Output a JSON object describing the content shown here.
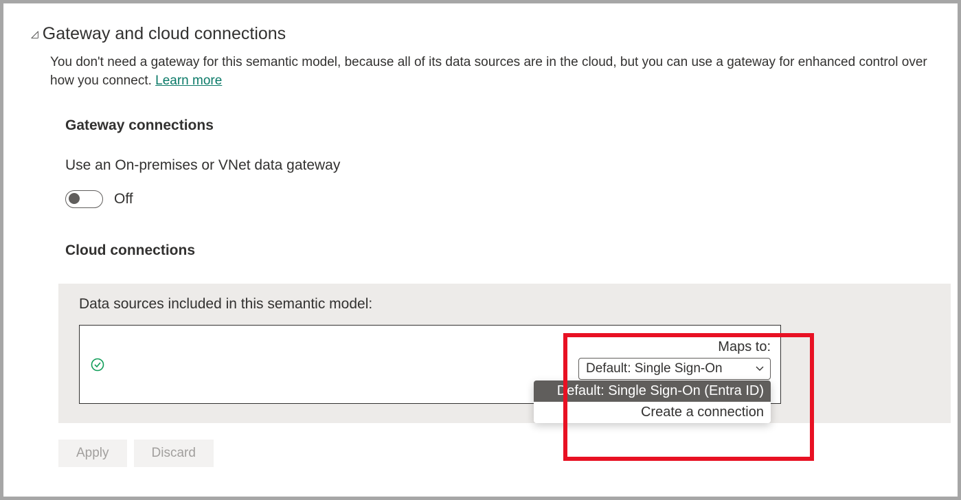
{
  "section": {
    "title": "Gateway and cloud connections",
    "description": "You don't need a gateway for this semantic model, because all of its data sources are in the cloud, but you can use a gateway for enhanced control over how you connect. ",
    "learnMore": "Learn more"
  },
  "gateway": {
    "title": "Gateway connections",
    "toggleLabel": "Use an On-premises or VNet data gateway",
    "toggleState": "Off"
  },
  "cloud": {
    "title": "Cloud connections",
    "dataSourcesLabel": "Data sources included in this semantic model:",
    "mapsToLabel": "Maps to:",
    "dropdownSelected": "Default: Single Sign-On ",
    "dropdownOptions": [
      "Default: Single Sign-On (Entra ID)",
      "Create a connection"
    ]
  },
  "buttons": {
    "apply": "Apply",
    "discard": "Discard"
  }
}
